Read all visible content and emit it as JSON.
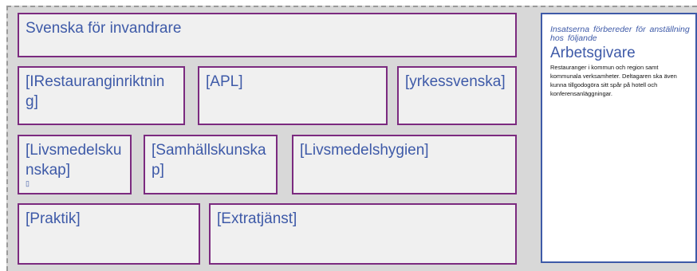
{
  "boxes": {
    "svenska": "Svenska för invandrare",
    "restaurang": "[IRestauranginriktning]",
    "apl": "[APL]",
    "yrkessvenska": "[yrkessvenska]",
    "livsmedelskunskap": "[Livsmedelskunskap]",
    "livsmedelskunskap_marker": "▯",
    "samhallskunskap": "[Samhällskunskap]",
    "livsmedelshygien": "[Livsmedelshygien]",
    "praktik": "[Praktik]",
    "extratjanst": "[Extratjänst]"
  },
  "side_panel": {
    "intro": "Insatserna förbereder för anställning hos följande",
    "heading": "Arbetsgivare",
    "body": "Restauranger i kommun och region samt kommunala verksamheter. Deltagaren ska även kunna tillgodogöra sitt spår på hotell och konferensanläggningar."
  },
  "colors": {
    "box_border": "#7b2a7f",
    "text": "#3e5aa8",
    "background": "#d8d8d8"
  }
}
